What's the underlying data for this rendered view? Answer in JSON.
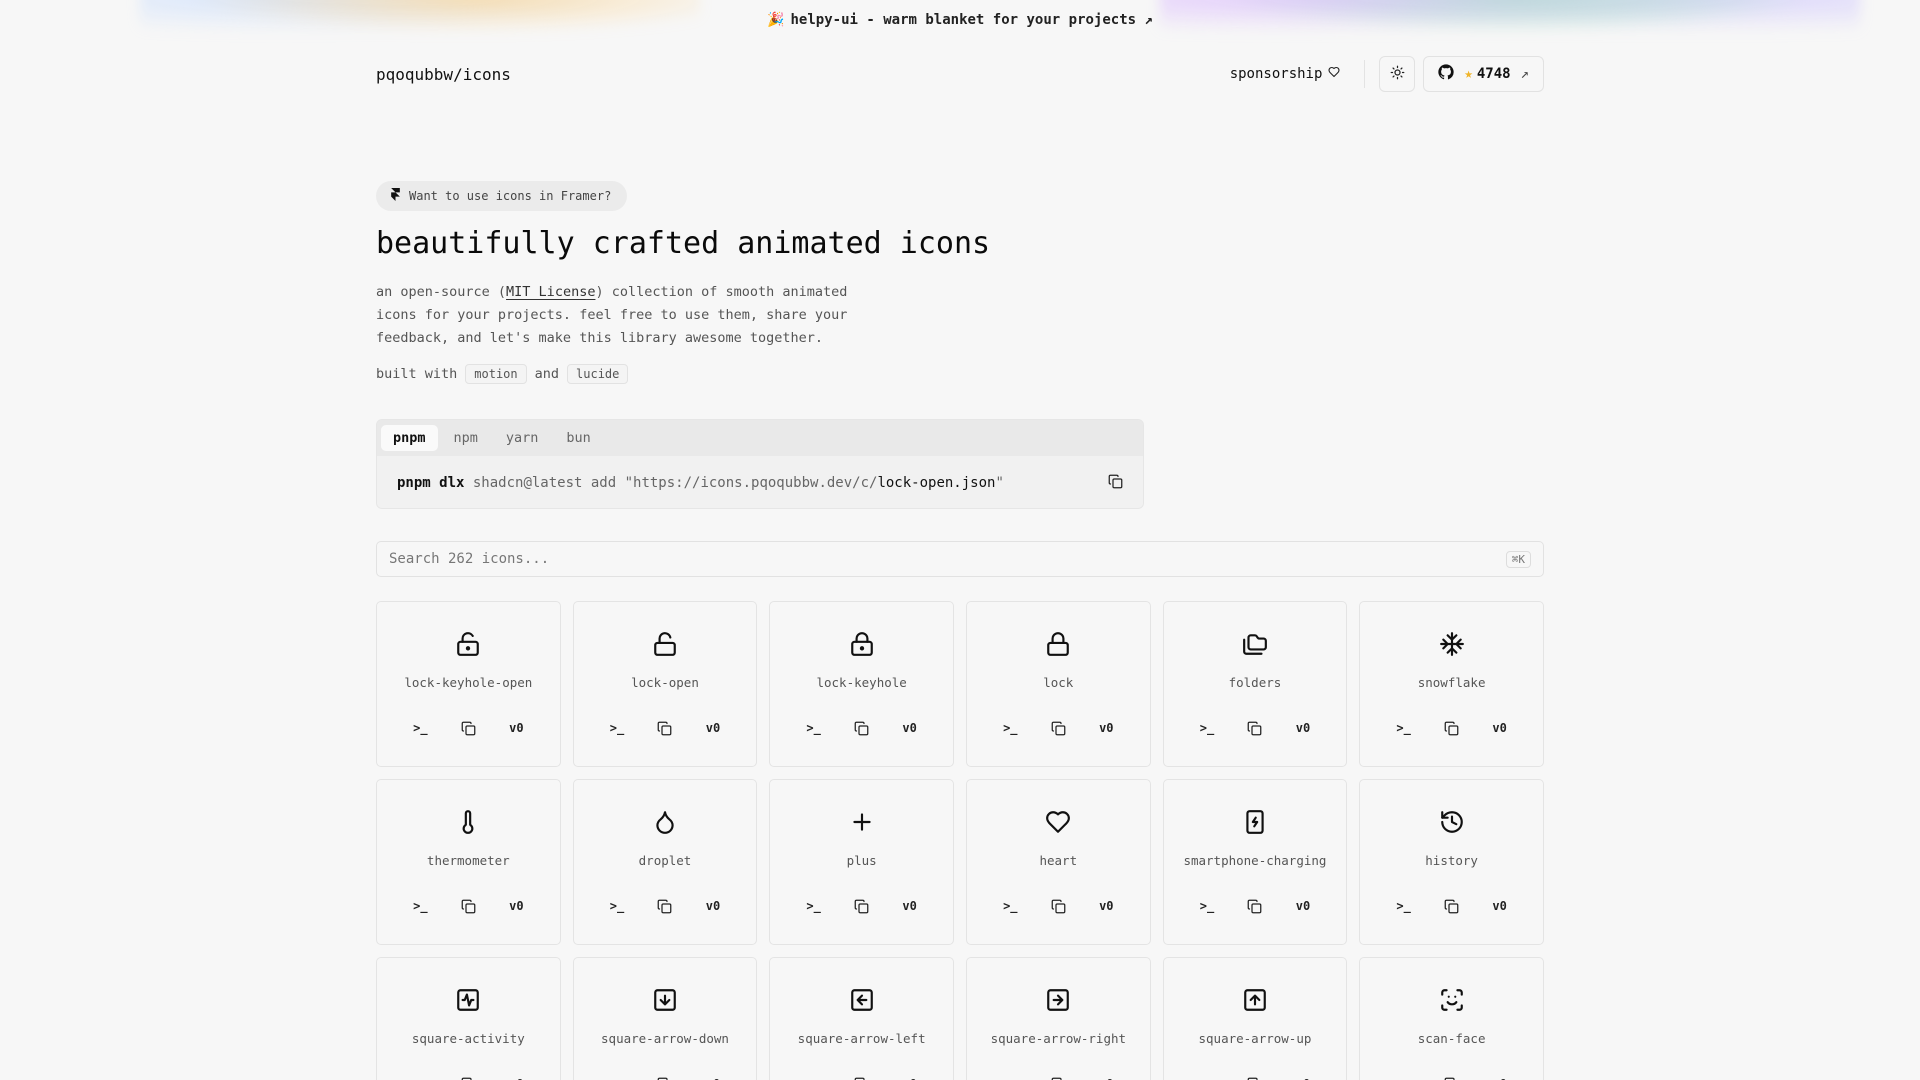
{
  "banner": {
    "emoji": "🎉",
    "text": "helpy-ui - warm blanket for your projects ↗"
  },
  "header": {
    "brand": "pqoqubbw/icons",
    "sponsor_label": "sponsorship",
    "stars": "4748"
  },
  "hero": {
    "framer_pill": "Want to use icons in Framer?",
    "title": "beautifully crafted animated icons",
    "desc_before": "an open-source (",
    "license": "MIT License",
    "desc_after": ") collection of smooth animated icons for your projects. feel free to use them, share your feedback, and let's make this library awesome together.",
    "built_with": "built with",
    "and": "and",
    "tag_motion": "motion",
    "tag_lucide": "lucide"
  },
  "install": {
    "tabs": [
      "pnpm",
      "npm",
      "yarn",
      "bun"
    ],
    "active_tab": "pnpm",
    "cmd_bin": "pnpm dlx",
    "cmd_middle": "shadcn@latest add \"https://icons.pqoqubbw.dev/c/",
    "cmd_file": "lock-open.json",
    "cmd_end": "\""
  },
  "search": {
    "placeholder": "Search 262 icons...",
    "shortcut": "⌘K"
  },
  "icons": [
    {
      "name": "lock-keyhole-open",
      "icon": "lock-keyhole-open-icon"
    },
    {
      "name": "lock-open",
      "icon": "lock-open-icon"
    },
    {
      "name": "lock-keyhole",
      "icon": "lock-keyhole-icon"
    },
    {
      "name": "lock",
      "icon": "lock-icon"
    },
    {
      "name": "folders",
      "icon": "folders-icon"
    },
    {
      "name": "snowflake",
      "icon": "snowflake-icon"
    },
    {
      "name": "thermometer",
      "icon": "thermometer-icon"
    },
    {
      "name": "droplet",
      "icon": "droplet-icon"
    },
    {
      "name": "plus",
      "icon": "plus-icon"
    },
    {
      "name": "heart",
      "icon": "heart-icon"
    },
    {
      "name": "smartphone-charging",
      "icon": "smartphone-charging-icon"
    },
    {
      "name": "history",
      "icon": "history-icon"
    },
    {
      "name": "square-activity",
      "icon": "square-activity-icon"
    },
    {
      "name": "square-arrow-down",
      "icon": "square-arrow-down-icon"
    },
    {
      "name": "square-arrow-left",
      "icon": "square-arrow-left-icon"
    },
    {
      "name": "square-arrow-right",
      "icon": "square-arrow-right-icon"
    },
    {
      "name": "square-arrow-up",
      "icon": "square-arrow-up-icon"
    },
    {
      "name": "scan-face",
      "icon": "scan-face-icon"
    }
  ],
  "card_actions": {
    "terminal": ">_",
    "v0": "v0"
  }
}
